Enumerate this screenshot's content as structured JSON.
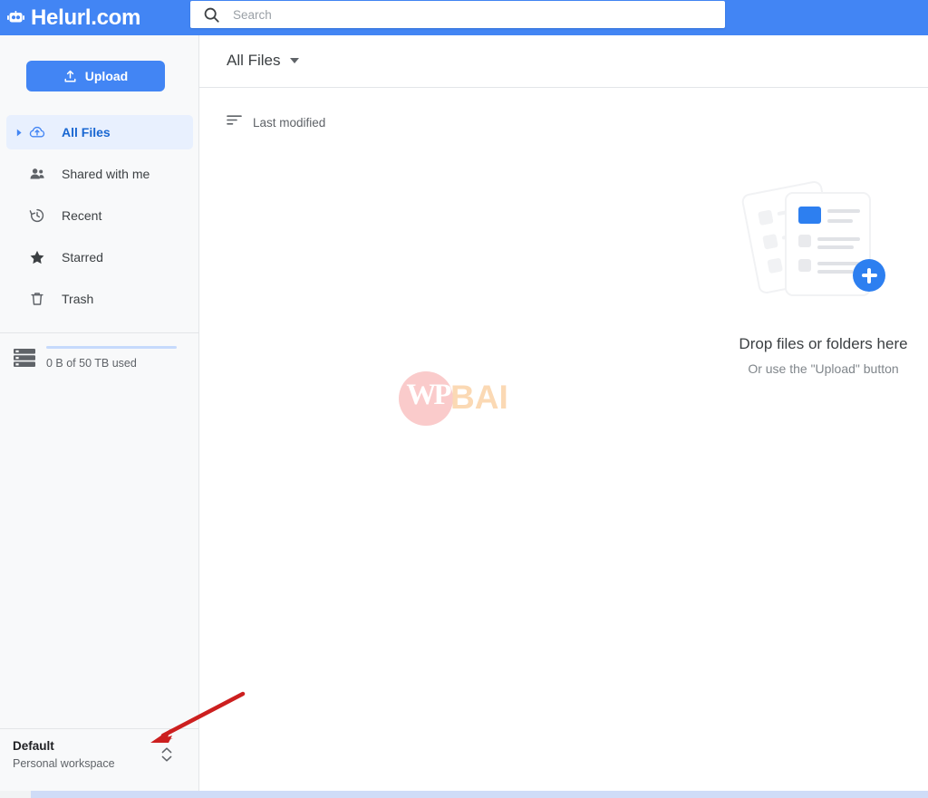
{
  "header": {
    "brand_name": "Helurl.com",
    "brand_icon": "robot-logo-icon",
    "accent_color": "#4285f4",
    "search": {
      "icon": "search-icon",
      "placeholder": "Search",
      "value": ""
    }
  },
  "sidebar": {
    "upload": {
      "label": "Upload",
      "icon": "upload-icon"
    },
    "items": [
      {
        "label": "All Files",
        "icon": "cloud-upload-icon",
        "active": true,
        "caret": "chevron-right-icon"
      },
      {
        "label": "Shared with me",
        "icon": "people-icon",
        "active": false,
        "caret": ""
      },
      {
        "label": "Recent",
        "icon": "clock-history-icon",
        "active": false,
        "caret": ""
      },
      {
        "label": "Starred",
        "icon": "star-icon",
        "active": false,
        "caret": ""
      },
      {
        "label": "Trash",
        "icon": "trash-icon",
        "active": false,
        "caret": ""
      }
    ],
    "storage": {
      "icon": "server-storage-icon",
      "text": "0 B of 50 TB used",
      "used_percent": 0,
      "bar_color": "#c6dafc"
    },
    "workspace": {
      "name": "Default",
      "subtitle": "Personal workspace",
      "switch_icon": "chevron-up-down-icon"
    }
  },
  "main": {
    "breadcrumb": {
      "label": "All Files",
      "icon": "chevron-down-icon"
    },
    "sort": {
      "label": "Last modified",
      "icon": "sort-descending-icon"
    },
    "empty_state": {
      "title": "Drop files or folders here",
      "subtitle": "Or use the \"Upload\" button",
      "illustration": "documents-with-plus-illustration",
      "badge_icon": "plus-circle-icon",
      "accent_color": "#2d7ff0"
    }
  },
  "watermark": {
    "monogram": "WP",
    "text": "BAI",
    "circle_color": "#f6a0a0",
    "text_color": "#fbd9b4"
  },
  "annotation": {
    "arrow_color": "#cc1f1f",
    "points_to": "workspace-switcher"
  }
}
